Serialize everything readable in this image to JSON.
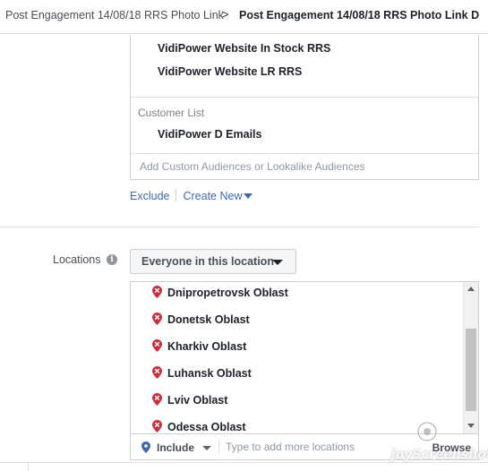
{
  "breadcrumb": {
    "campaign": "Post Engagement 14/08/18 RRS Photo Link",
    "separator": ">",
    "ad_set": "Post Engagement 14/08/18 RRS Photo Link D"
  },
  "custom_audiences": {
    "items": [
      "VidiPower Website In Stock RRS",
      "VidiPower Website LR RRS"
    ],
    "group_label": "Customer List",
    "group_items": [
      "VidiPower D Emails"
    ],
    "search_placeholder": "Add Custom Audiences or Lookalike Audiences",
    "exclude_label": "Exclude",
    "create_new_label": "Create New"
  },
  "locations": {
    "label": "Locations",
    "info_glyph": "i",
    "dropdown_value": "Everyone in this location",
    "items": [
      "Dnipropetrovsk Oblast",
      "Donetsk Oblast",
      "Kharkiv Oblast",
      "Luhansk Oblast",
      "Lviv Oblast",
      "Odessa Oblast"
    ],
    "include_label": "Include",
    "search_placeholder": "Type to add more locations",
    "browse_label": "Browse"
  },
  "watermark": "joyScreenshot",
  "colors": {
    "link": "#4267b2",
    "pin": "#c8323f",
    "border": "#ccd0d5",
    "muted_text": "#9197a3"
  },
  "icons": {
    "breadcrumb_separator": "chevron-right-icon",
    "location_item": "map-pin-x-icon",
    "include": "map-pin-icon",
    "info": "info-icon"
  }
}
